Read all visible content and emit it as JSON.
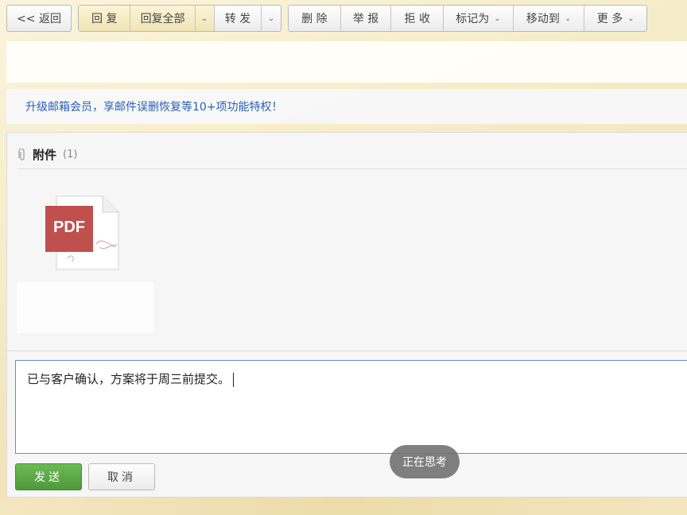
{
  "toolbar": {
    "back": "<< 返回",
    "reply": "回 复",
    "reply_all": "回复全部",
    "forward": "转 发",
    "delete": "删 除",
    "report": "举 报",
    "reject": "拒 收",
    "mark_as": "标记为",
    "move_to": "移动到",
    "more": "更 多"
  },
  "promo": {
    "text": "升级邮箱会员，享邮件误删恢复等10+项功能特权！"
  },
  "attachments": {
    "title": "附件",
    "count": "(1)",
    "file_badge": "PDF",
    "accent": "#c0504d"
  },
  "reply_box": {
    "text": "已与客户确认，方案将于周三前提交。"
  },
  "actions": {
    "send": "发送",
    "cancel": "取消"
  },
  "toast": {
    "text": "正在思考"
  },
  "colors": {
    "send": "#5aaa45",
    "link": "#2a5fb4",
    "border_focus": "#6f8ad1"
  }
}
